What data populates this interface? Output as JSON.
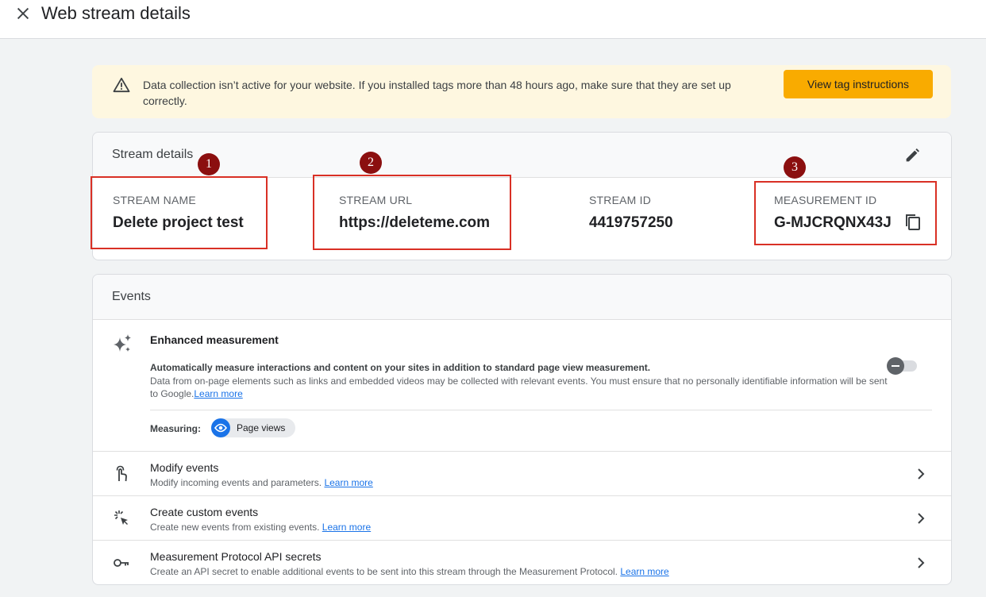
{
  "header": {
    "title": "Web stream details"
  },
  "banner": {
    "message": "Data collection isn’t active for your website. If you installed tags more than 48 hours ago, make sure that they are set up correctly.",
    "button_label": "View tag instructions"
  },
  "stream": {
    "section_title": "Stream details",
    "name_label": "STREAM NAME",
    "name_value": "Delete project test",
    "url_label": "STREAM URL",
    "url_value": "https://deleteme.com",
    "id_label": "STREAM ID",
    "id_value": "4419757250",
    "measurement_label": "MEASUREMENT ID",
    "measurement_value": "G-MJCRQNX43J"
  },
  "callouts": [
    "1",
    "2",
    "3"
  ],
  "events": {
    "section_title": "Events",
    "enhanced": {
      "title": "Enhanced measurement",
      "desc_bold": "Automatically measure interactions and content on your sites in addition to standard page view measurement.",
      "desc": "Data from on-page elements such as links and embedded videos may be collected with relevant events. You must ensure that no personally identifiable information will be sent to Google.",
      "learn_more": "Learn more",
      "measuring_label": "Measuring:",
      "chip_label": "Page views",
      "enabled": false
    },
    "rows": [
      {
        "title": "Modify events",
        "desc": "Modify incoming events and parameters.",
        "link": "Learn more",
        "icon": "touch-icon"
      },
      {
        "title": "Create custom events",
        "desc": "Create new events from existing events.",
        "link": "Learn more",
        "icon": "sparkle-click-icon"
      },
      {
        "title": "Measurement Protocol API secrets",
        "desc": "Create an API secret to enable additional events to be sent into this stream through the Measurement Protocol.",
        "link": "Learn more",
        "icon": "key-icon"
      }
    ]
  },
  "colors": {
    "accent": "#1a73e8",
    "warning_button": "#f9ab00",
    "banner_bg": "#fef7e0",
    "highlight": "#d93025",
    "callout": "#8b0f0f"
  }
}
